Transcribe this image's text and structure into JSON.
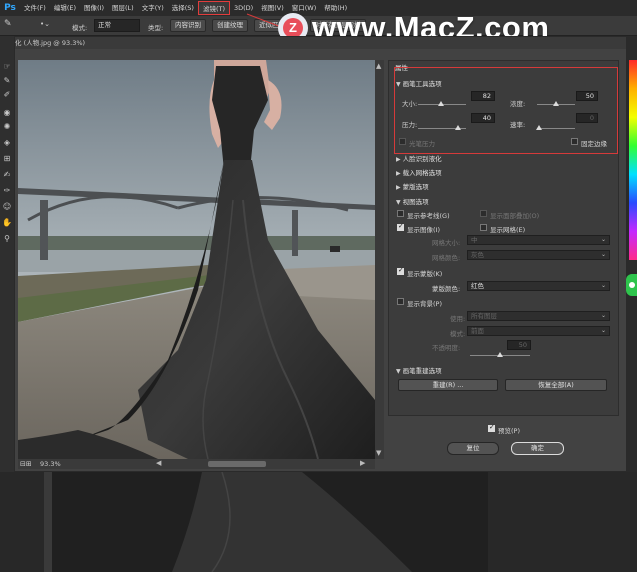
{
  "app": {
    "logo": "Ps"
  },
  "menu": {
    "items": [
      {
        "label": "文件(F)"
      },
      {
        "label": "编辑(E)"
      },
      {
        "label": "图像(I)"
      },
      {
        "label": "图层(L)"
      },
      {
        "label": "文字(Y)"
      },
      {
        "label": "选择(S)"
      },
      {
        "label": "滤镜(T)",
        "active": true
      },
      {
        "label": "3D(D)"
      },
      {
        "label": "视图(V)"
      },
      {
        "label": "窗口(W)"
      },
      {
        "label": "帮助(H)"
      }
    ]
  },
  "options": {
    "mode_label": "模式:",
    "mode_value": "正常",
    "type_label": "类型:",
    "btn_content_aware": "内容识别",
    "btn_create_texture": "创建纹理",
    "btn_proximity": "近似匹配",
    "btn_sample_all": "对所有图层取样"
  },
  "watermark": {
    "badge_letter": "Z",
    "text": "www.MacZ.com"
  },
  "dialog": {
    "title": "化 (人物.jpg @ 93.3%)",
    "zoom": "93.3%"
  },
  "props": {
    "header": "属性",
    "brush_tool": {
      "title": "画笔工具选项",
      "size_label": "大小:",
      "size_value": "82",
      "density_label": "浓度:",
      "density_value": "50",
      "pressure_label": "压力:",
      "pressure_value": "40",
      "rate_label": "速率:",
      "rate_value": "0",
      "stylus_label": "光笔压力",
      "pin_edges_label": "固定边缘"
    },
    "face_aware": "人脸识别液化",
    "load_mesh": "载入网格选项",
    "mask_options": "蒙版选项",
    "view_options": {
      "title": "视图选项",
      "show_guides": "显示参考线(G)",
      "show_face_overlay": "显示面部叠加(O)",
      "show_image": "显示图像(I)",
      "show_mesh": "显示网格(E)",
      "mesh_size_label": "网格大小:",
      "mesh_size_value": "中",
      "mesh_color_label": "网格颜色:",
      "mesh_color_value": "灰色",
      "show_mask": "显示蒙版(K)",
      "mask_color_label": "蒙版颜色:",
      "mask_color_value": "红色",
      "show_backdrop": "显示背景(P)",
      "use_label": "使用:",
      "use_value": "所有图层",
      "mode_label": "模式:",
      "mode_value": "前面",
      "opacity_label": "不透明度:",
      "opacity_value": "50"
    },
    "reconstruct": {
      "title": "画笔重建选项",
      "rebuild_btn": "重建(R) ...",
      "restore_all_btn": "恢复全部(A)"
    }
  },
  "footer": {
    "preview_label": "预览(P)",
    "reset_btn": "复位",
    "ok_btn": "确定"
  }
}
